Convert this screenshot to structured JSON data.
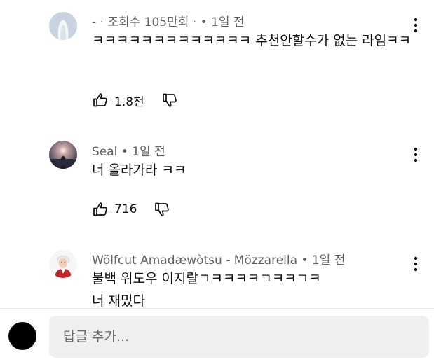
{
  "comments": [
    {
      "author": "- · 조회수 105만회 ·",
      "time": "• 1일 전",
      "text": "ㅋㅋㅋㅋㅋㅋㅋㅋㅋㅋㅋㅋㅋ 추천안할수가 없는 라임ㅋㅋ",
      "likes": "1.8천",
      "avatar": "ghost-avatar-icon"
    },
    {
      "author": "Seal",
      "time": "• 1일 전",
      "text": "너 올라가라 ㅋㅋ",
      "likes": "716",
      "avatar": "sunset-silhouette-avatar"
    },
    {
      "author": "Wölfcut Amadæwòtsu - Mözzarella",
      "time": "• 1일 전",
      "text": "불백 위도우 이지랄ㄱㅋㅋㅋㅋㄱㅋㅋㄱㅋ\n너 재밌다",
      "likes": "",
      "avatar": "mozart-portrait-avatar"
    }
  ],
  "reply": {
    "placeholder": "답글 추가..."
  },
  "icons": {
    "like": "thumbs-up-icon",
    "dislike": "thumbs-down-icon",
    "more": "kebab-menu-icon"
  },
  "colors": {
    "text": "#0f0f0f",
    "meta": "#606060",
    "input_bg": "#efefef",
    "divider": "#e5e5e5"
  }
}
